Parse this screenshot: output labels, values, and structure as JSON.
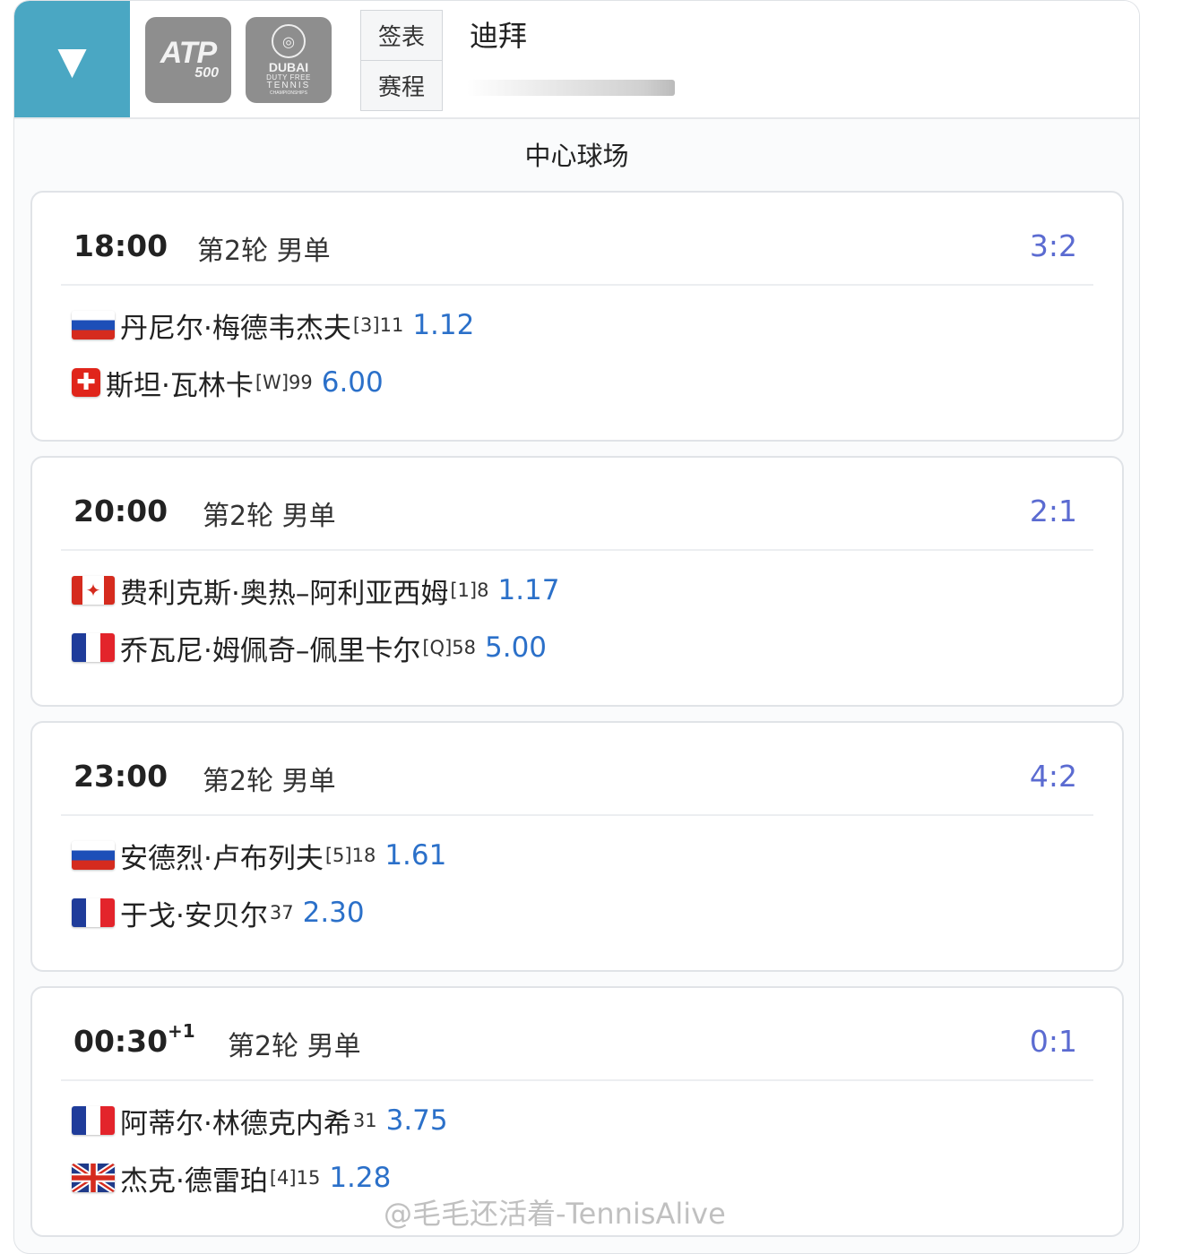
{
  "header": {
    "toggle_icon": "▼",
    "atp_logo": {
      "text": "ATP",
      "sub": "500"
    },
    "dubai_logo": {
      "line1": "DUBAI",
      "line2": "DUTY FREE",
      "line3": "TENNIS",
      "line4": "CHAMPIONSHIPS"
    },
    "nav": {
      "draw_label": "签表",
      "schedule_label": "赛程"
    },
    "city": "迪拜"
  },
  "court_title": "中心球场",
  "matches": [
    {
      "time": "18:00",
      "time_suffix": "",
      "round": "第2轮 男单",
      "score": "3:2",
      "players": [
        {
          "flag": "russia",
          "name": "丹尼尔·梅德韦杰夫",
          "seed": "[3]11",
          "odds": "1.12"
        },
        {
          "flag": "switzerland",
          "name": "斯坦·瓦林卡",
          "seed": "[W]99",
          "odds": "6.00"
        }
      ]
    },
    {
      "time": "20:00",
      "time_suffix": "",
      "round": "第2轮 男单",
      "score": "2:1",
      "players": [
        {
          "flag": "canada",
          "name": "费利克斯·奥热–阿利亚西姆",
          "seed": "[1]8",
          "odds": "1.17"
        },
        {
          "flag": "france",
          "name": "乔瓦尼·姆佩奇–佩里卡尔",
          "seed": "[Q]58",
          "odds": "5.00"
        }
      ]
    },
    {
      "time": "23:00",
      "time_suffix": "",
      "round": "第2轮 男单",
      "score": "4:2",
      "players": [
        {
          "flag": "russia",
          "name": "安德烈·卢布列夫",
          "seed": "[5]18",
          "odds": "1.61"
        },
        {
          "flag": "france",
          "name": "于戈·安贝尔",
          "seed": "37",
          "odds": "2.30"
        }
      ]
    },
    {
      "time": "00:30",
      "time_suffix": "+1",
      "round": "第2轮 男单",
      "score": "0:1",
      "players": [
        {
          "flag": "france",
          "name": "阿蒂尔·林德克内希",
          "seed": "31",
          "odds": "3.75"
        },
        {
          "flag": "uk",
          "name": "杰克·德雷珀",
          "seed": "[4]15",
          "odds": "1.28"
        }
      ]
    }
  ],
  "watermark": "@毛毛还活着-TennisAlive",
  "colors": {
    "accent": "#4aa7c3",
    "score": "#5b6bd1",
    "odds": "#2b70c9"
  }
}
